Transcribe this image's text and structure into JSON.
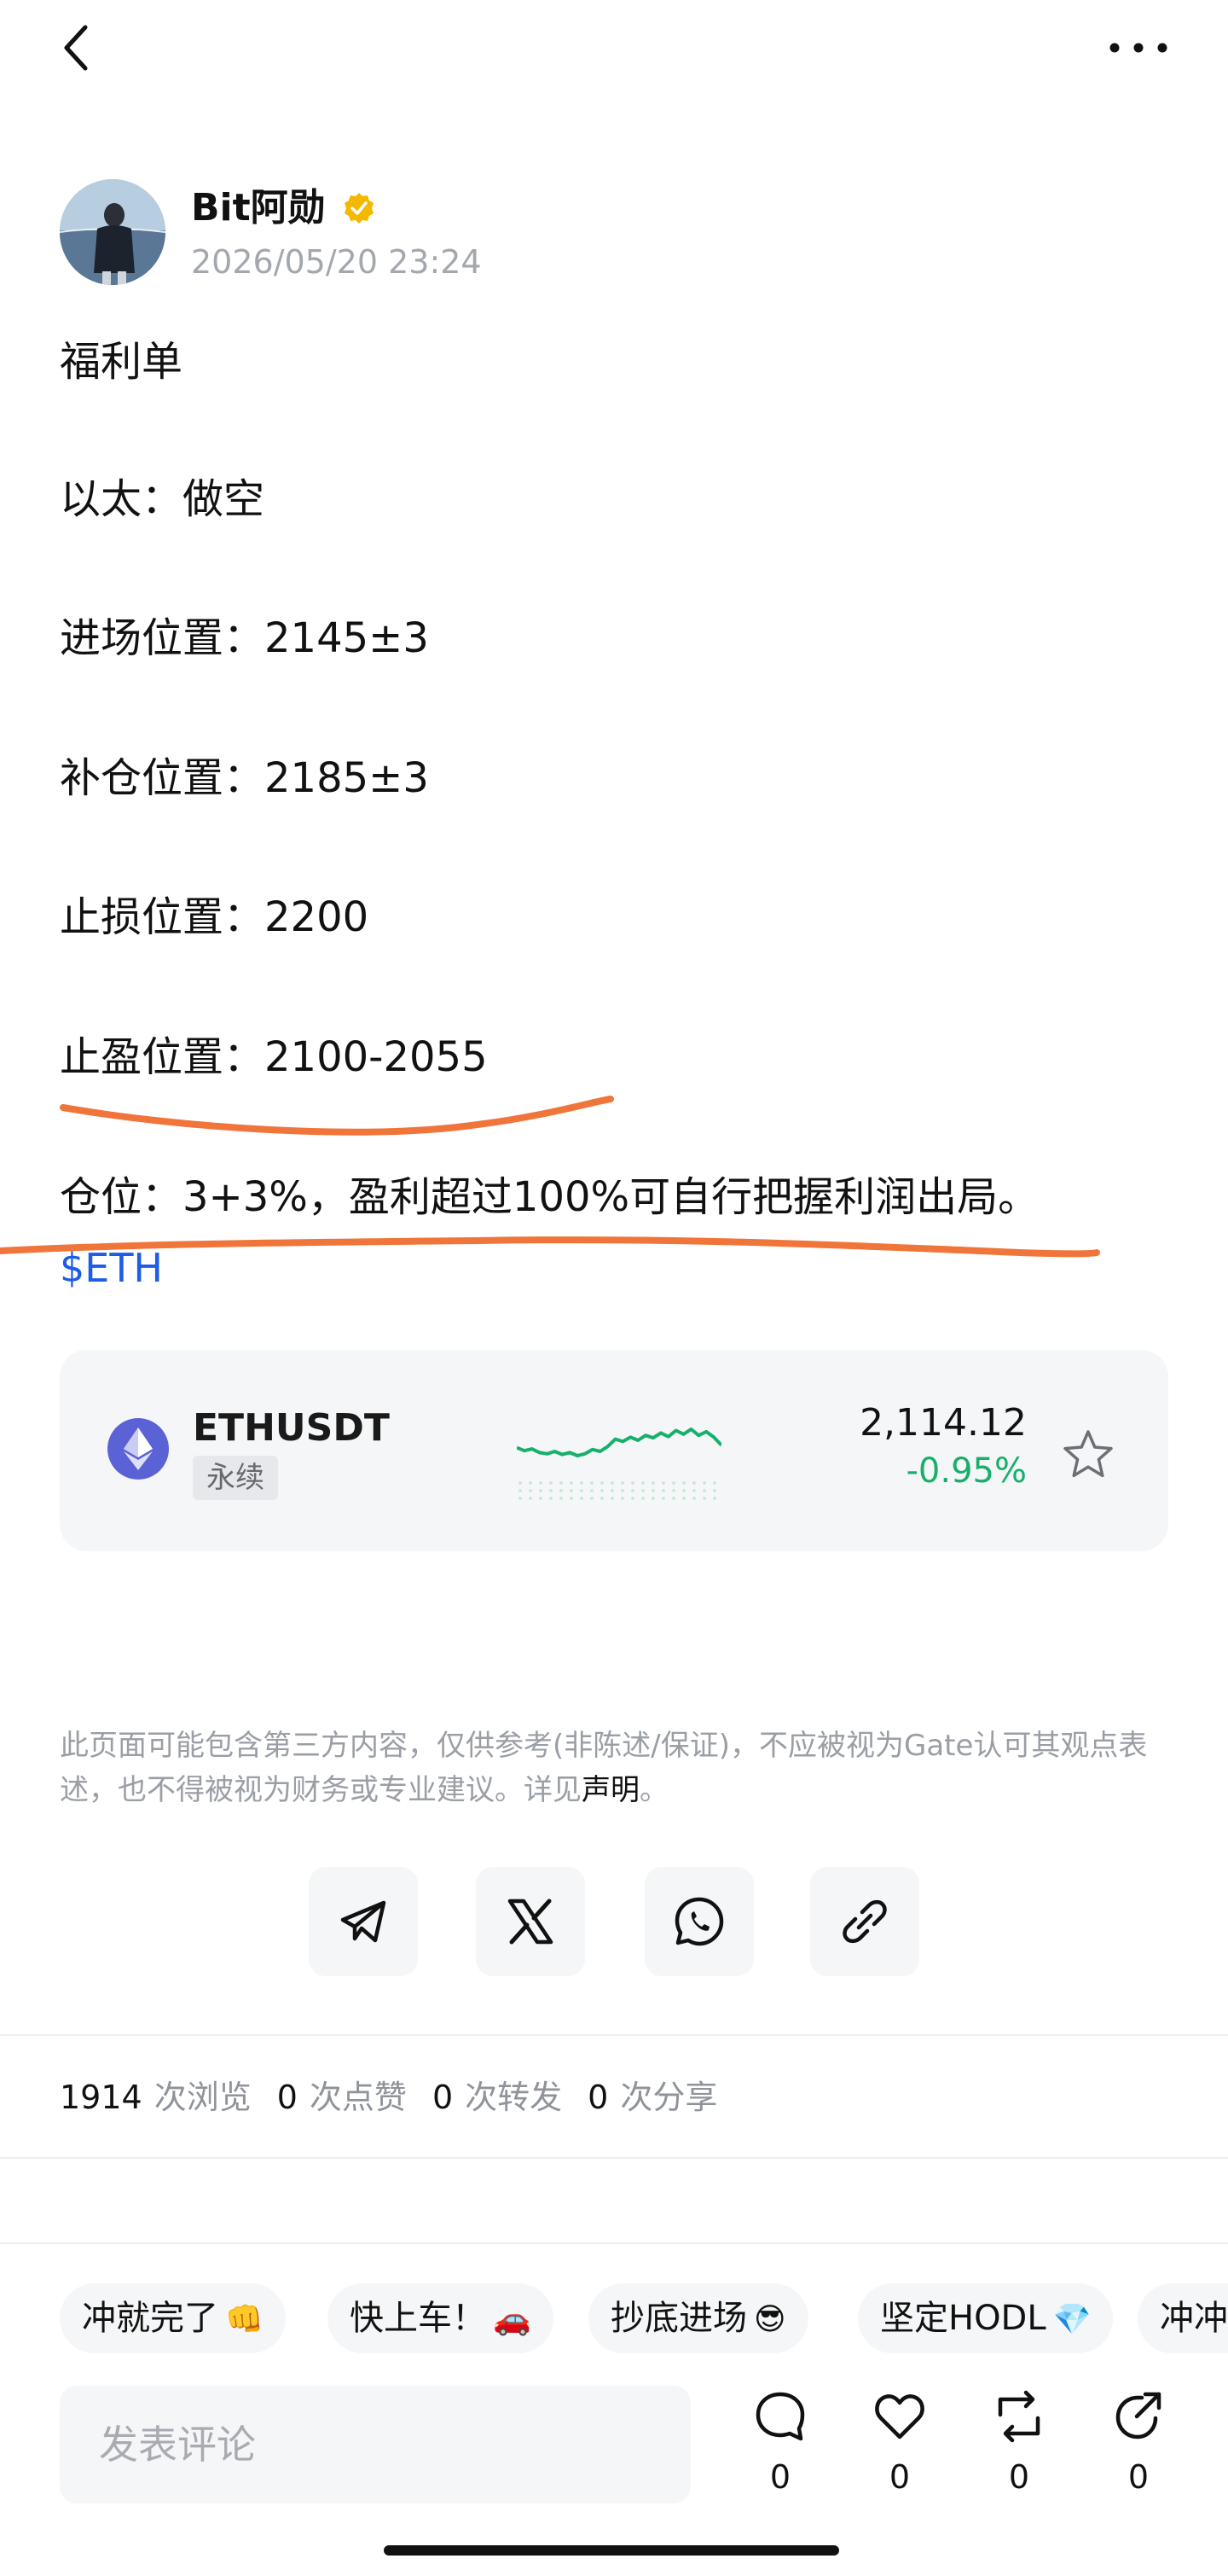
{
  "author": {
    "name": "Bit阿勋",
    "time": "2026/05/20 23:24"
  },
  "post": {
    "lines": [
      "福利单",
      "以太：做空",
      "进场位置：2145±3",
      "补仓位置：2185±3",
      "止损位置：2200",
      "止盈位置：2100-2055",
      "仓位：3+3%，盈利超过100%可自行把握利润出局。"
    ],
    "tag": "$ETH"
  },
  "market": {
    "pair": "ETHUSDT",
    "badge": "永续",
    "price": "2,114.12",
    "change": "-0.95%",
    "sparkline_trend": [
      0.38,
      0.33,
      0.36,
      0.3,
      0.28,
      0.32,
      0.27,
      0.3,
      0.25,
      0.28,
      0.35,
      0.32,
      0.4,
      0.52,
      0.48,
      0.55,
      0.5,
      0.58,
      0.54,
      0.62,
      0.56,
      0.66,
      0.6,
      0.68,
      0.58,
      0.64,
      0.55,
      0.42
    ]
  },
  "disclaimer": {
    "text": "此页面可能包含第三方内容，仅供参考(非陈述/保证)，不应被视为Gate认可其观点表述，也不得被视为财务或专业建议。详见",
    "link": "声明",
    "end": "。"
  },
  "share": {
    "items": [
      "telegram-icon",
      "x-icon",
      "whatsapp-icon",
      "link-icon"
    ]
  },
  "stats": {
    "views": "1914",
    "views_label": "次浏览",
    "likes": "0",
    "likes_label": "次点赞",
    "reposts": "0",
    "reposts_label": "次转发",
    "shares": "0",
    "shares_label": "次分享"
  },
  "chips": [
    {
      "label": "冲就完了",
      "emoji": "👊"
    },
    {
      "label": "快上车！",
      "emoji": "🚗"
    },
    {
      "label": "抄底进场",
      "emoji": "😎"
    },
    {
      "label": "坚定HODL",
      "emoji": "💎"
    },
    {
      "label": "冲冲",
      "emoji": ""
    }
  ],
  "comment": {
    "placeholder": "发表评论"
  },
  "actions": {
    "comment_count": "0",
    "like_count": "0",
    "repost_count": "0",
    "share_count": "0"
  },
  "colors": {
    "accent_green": "#17b06b",
    "link_blue": "#1e5ce6",
    "annotation_orange": "#f0753a",
    "verified_gold": "#f5b800"
  }
}
